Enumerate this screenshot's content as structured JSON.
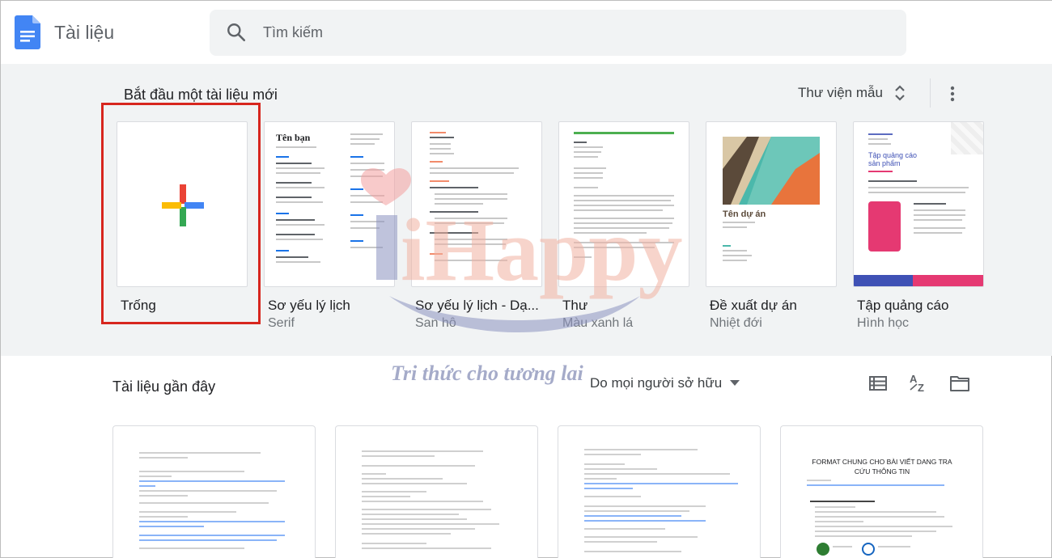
{
  "header": {
    "app_title": "Tài liệu",
    "search_placeholder": "Tìm kiếm"
  },
  "gallery": {
    "title": "Bắt đầu một tài liệu mới",
    "toggle_label": "Thư viện mẫu",
    "templates": [
      {
        "name": "Trống",
        "sub": ""
      },
      {
        "name": "Sơ yếu lý lịch",
        "sub": "Serif",
        "thumb_title": "Tên bạn"
      },
      {
        "name": "Sơ yếu lý lịch - Dạ...",
        "sub": "San hô"
      },
      {
        "name": "Thư",
        "sub": "Màu xanh lá"
      },
      {
        "name": "Đề xuất dự án",
        "sub": "Nhiệt đới",
        "thumb_title": "Tên dự án"
      },
      {
        "name": "Tập quảng cáo",
        "sub": "Hình học",
        "thumb_title": "Tập quảng cáo sản phẩm"
      }
    ]
  },
  "recent": {
    "title": "Tài liệu gần đây",
    "owner_filter": "Do mọi người sở hữu",
    "docs": [
      {
        "preview": ""
      },
      {
        "preview": ""
      },
      {
        "preview": ""
      },
      {
        "preview": "FORMAT CHUNG CHO BÀI VIẾT DANG TRA CỨU THÔNG TIN"
      }
    ]
  },
  "watermark": {
    "logo_text": "iHappy",
    "tagline": "Tri thức cho tương lai"
  },
  "colors": {
    "docs_blue": "#4285f4",
    "gallery_bg": "#f1f3f4",
    "selection_red": "#d7261e"
  },
  "icons": [
    "docs-logo-icon",
    "search-icon",
    "unfold-icon",
    "more-vert-icon",
    "plus-icon",
    "list-view-icon",
    "sort-az-icon",
    "folder-icon",
    "caret-down-icon"
  ]
}
